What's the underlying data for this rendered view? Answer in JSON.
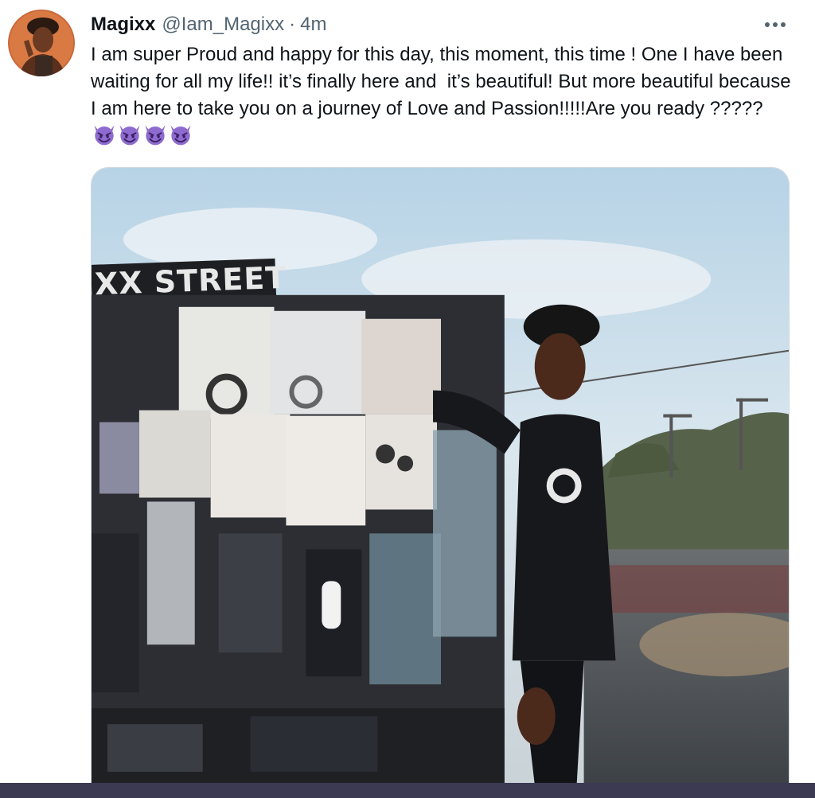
{
  "user": {
    "display_name": "Magixx",
    "handle": "@Iam_Magixx",
    "separator": "·",
    "timestamp": "4m",
    "avatar_icon": "profile-avatar"
  },
  "tweet": {
    "text": "I am super Proud and happy for this day, this moment, this time ! One I have been waiting for all my life!! it’s finally here and  it’s beautiful! But more beautiful because I am here to take you on a journey of Love and Passion!!!!!Are you ready ?????",
    "emoji_name": "smiling-face-with-horns-emoji",
    "emoji_count": 4
  },
  "media": {
    "sign_text": "XX STREET"
  },
  "icons": {
    "more": "more-horizontal-icon"
  },
  "colors": {
    "text_primary": "#0f1419",
    "text_secondary": "#536471",
    "border": "#cfd9de",
    "emoji_purple": "#8e6ccf",
    "bottom_bar": "#3b3a52"
  }
}
